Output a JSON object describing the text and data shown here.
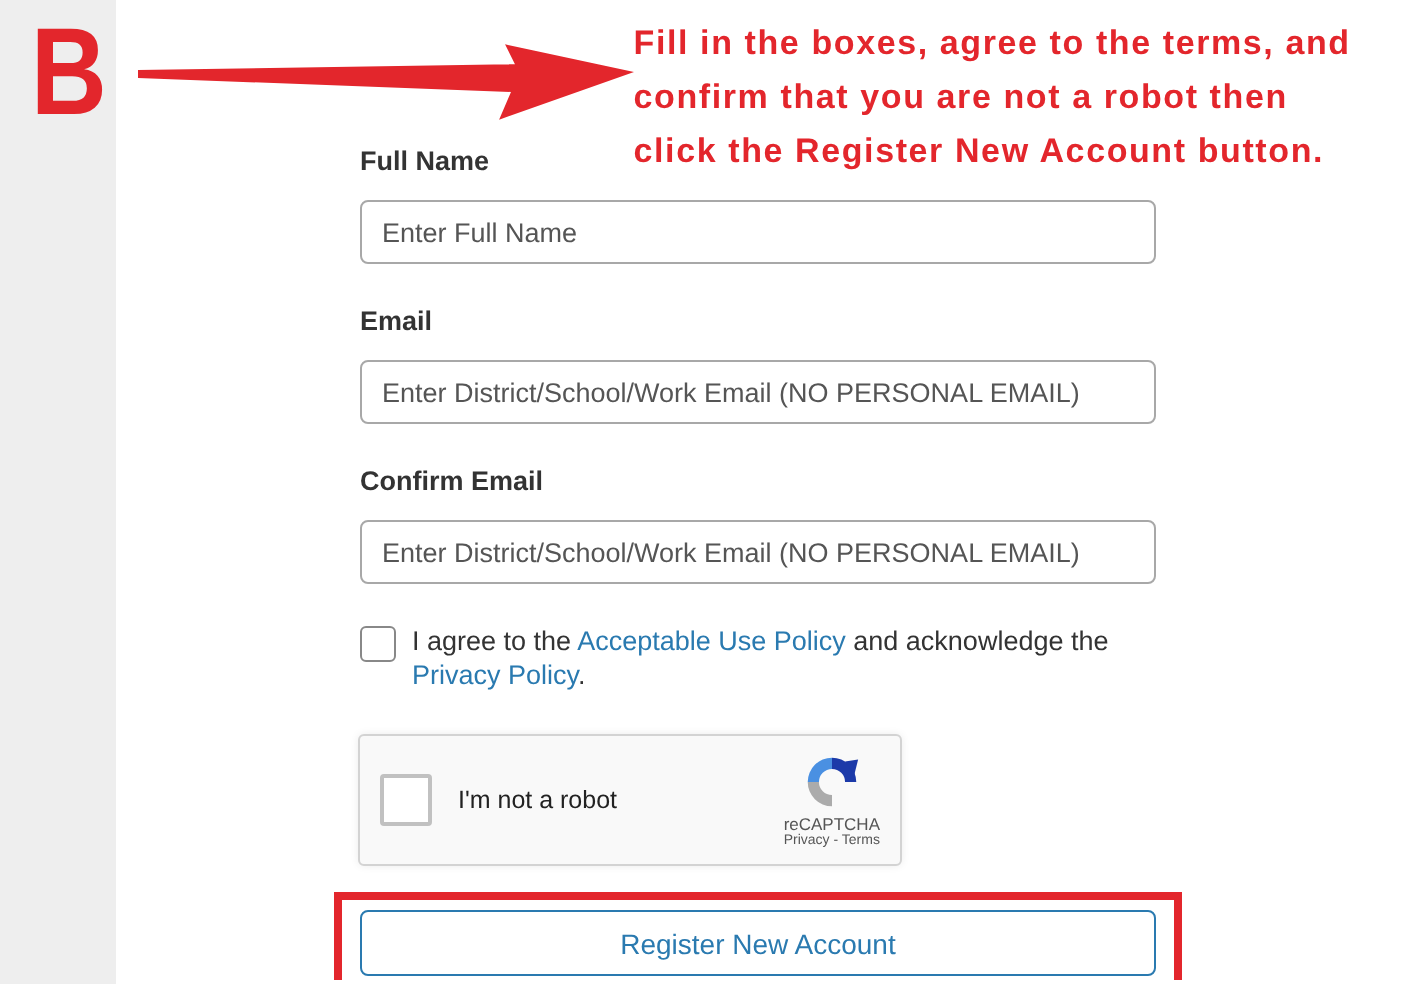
{
  "step_badge": "B",
  "annotation": {
    "lines": [
      "Fill in the boxes, agree to the terms, and",
      "confirm that you are not a robot then",
      "click the Register New Account button."
    ]
  },
  "fields": [
    {
      "label": "Full Name",
      "placeholder": "Enter Full Name"
    },
    {
      "label": "Email",
      "placeholder": "Enter District/School/Work Email (NO PERSONAL EMAIL)"
    },
    {
      "label": "Confirm Email",
      "placeholder": "Enter District/School/Work Email (NO PERSONAL EMAIL)"
    }
  ],
  "agreement": {
    "checked": false,
    "parts": [
      {
        "kind": "text",
        "text": "I agree to the "
      },
      {
        "kind": "link",
        "text": "Acceptable Use Policy"
      },
      {
        "kind": "text",
        "text": " and acknowledge the "
      },
      {
        "kind": "link",
        "text": "Privacy Policy"
      },
      {
        "kind": "text",
        "text": "."
      }
    ]
  },
  "captcha": {
    "checked": false,
    "label": "I'm not a robot",
    "brand": "reCAPTCHA",
    "links": "Privacy - Terms"
  },
  "register_button": {
    "label": "Register New Account",
    "highlighted": true
  }
}
